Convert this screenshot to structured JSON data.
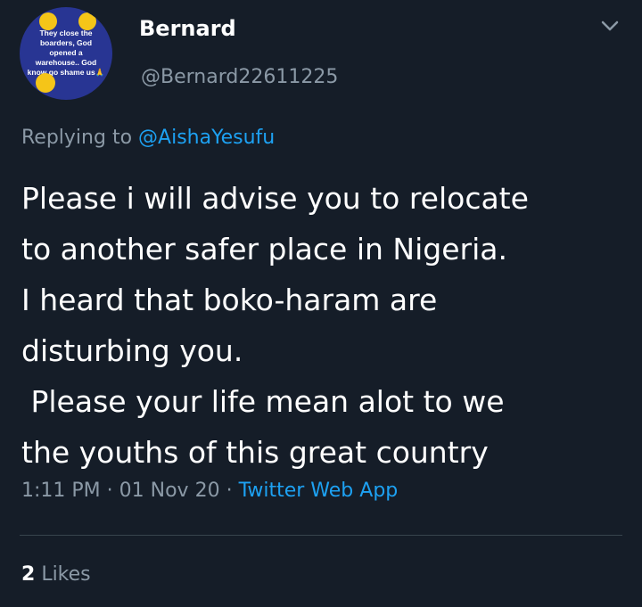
{
  "author": {
    "display_name": "Bernard",
    "handle": "@Bernard22611225",
    "avatar_text": "They close the boarders, God opened a warehouse.. God know go shame us🙏"
  },
  "reply": {
    "prefix": "Replying to",
    "mention": "@AishaYesufu"
  },
  "tweet": {
    "lines": [
      "Please i will advise you to relocate",
      "to another safer place in Nigeria.",
      "I heard that boko-haram are",
      "disturbing you.",
      " Please your life mean alot to we",
      "the youths of this great country"
    ]
  },
  "meta": {
    "time": "1:11 PM",
    "date": "01 Nov 20",
    "separator": "·",
    "app": "Twitter Web App"
  },
  "stats": {
    "likes_count": "2",
    "likes_label": "Likes"
  },
  "colors": {
    "background": "#151d28",
    "muted": "#8b99a6",
    "accent": "#1da1f2",
    "divider": "#38444d",
    "avatar_bg": "#283593"
  }
}
